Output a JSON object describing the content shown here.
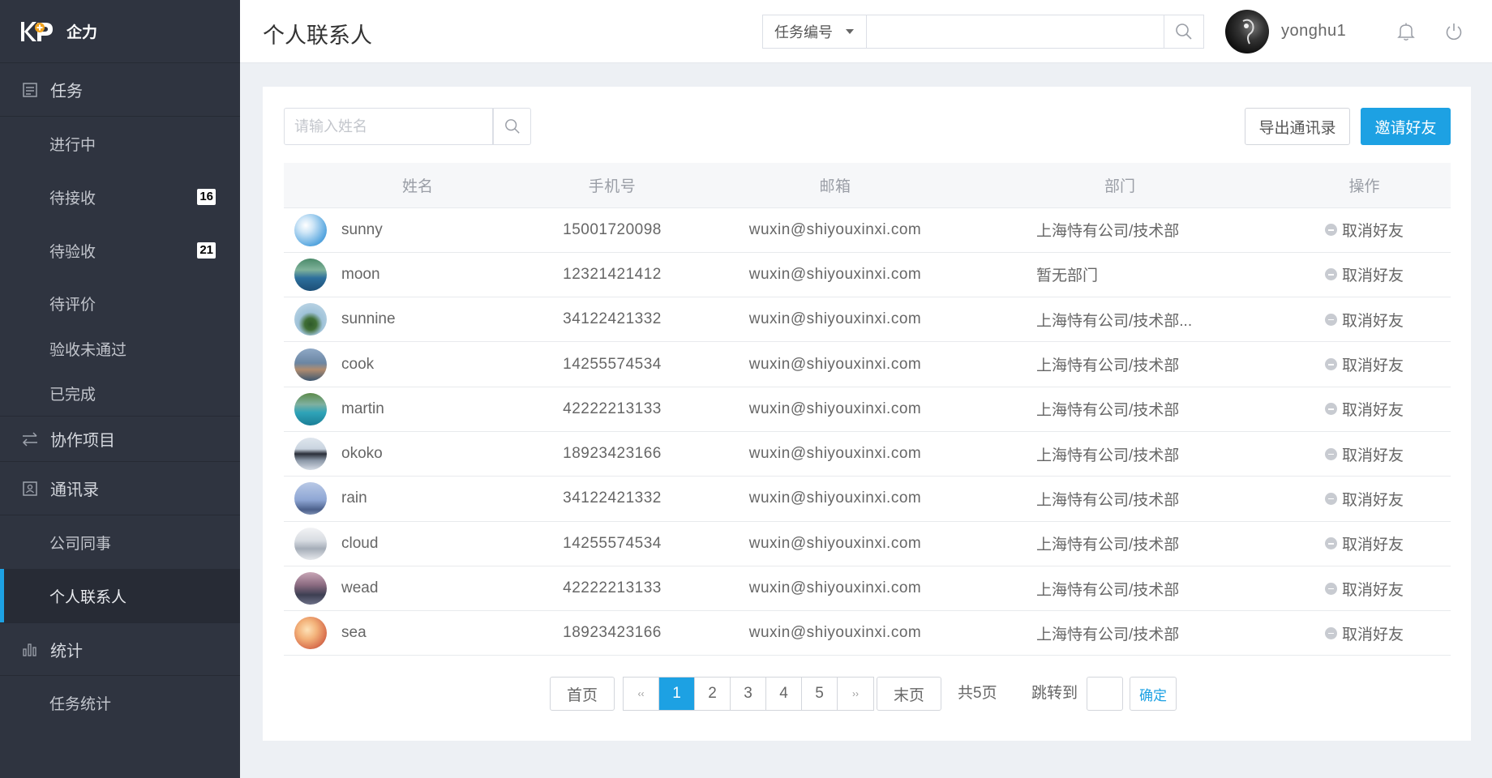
{
  "brand": {
    "name": "企力"
  },
  "sidebar": {
    "groups": [
      {
        "label": "任务",
        "icon": "task-icon"
      },
      {
        "label": "协作项目",
        "icon": "swap-icon"
      },
      {
        "label": "通讯录",
        "icon": "contacts-icon"
      },
      {
        "label": "统计",
        "icon": "bar-chart-icon"
      }
    ],
    "task_items": [
      {
        "label": "进行中"
      },
      {
        "label": "待接收",
        "badge": "16"
      },
      {
        "label": "待验收",
        "badge": "21"
      },
      {
        "label": "待评价"
      },
      {
        "label": "验收未通过"
      },
      {
        "label": "已完成"
      }
    ],
    "contact_items": [
      {
        "label": "公司同事"
      },
      {
        "label": "个人联系人"
      }
    ],
    "stats_items": [
      {
        "label": "任务统计"
      }
    ]
  },
  "header": {
    "title": "个人联系人",
    "search_type": "任务编号",
    "search_value": "",
    "username": "yonghu1"
  },
  "toolbar": {
    "name_placeholder": "请输入姓名",
    "export_label": "导出通讯录",
    "invite_label": "邀请好友"
  },
  "table": {
    "columns": [
      "姓名",
      "手机号",
      "邮箱",
      "部门",
      "操作"
    ],
    "rows": [
      {
        "name": "sunny",
        "phone": "15001720098",
        "email": "wuxin@shiyouxinxi.com",
        "dept": "上海恃有公司/技术部",
        "op": "取消好友"
      },
      {
        "name": "moon",
        "phone": "12321421412",
        "email": "wuxin@shiyouxinxi.com",
        "dept": "暂无部门",
        "op": "取消好友"
      },
      {
        "name": "sunnine",
        "phone": "34122421332",
        "email": "wuxin@shiyouxinxi.com",
        "dept": "上海恃有公司/技术部...",
        "op": "取消好友"
      },
      {
        "name": "cook",
        "phone": "14255574534",
        "email": "wuxin@shiyouxinxi.com",
        "dept": "上海恃有公司/技术部",
        "op": "取消好友"
      },
      {
        "name": "martin",
        "phone": "42222213133",
        "email": "wuxin@shiyouxinxi.com",
        "dept": "上海恃有公司/技术部",
        "op": "取消好友"
      },
      {
        "name": "okoko",
        "phone": "18923423166",
        "email": "wuxin@shiyouxinxi.com",
        "dept": "上海恃有公司/技术部",
        "op": "取消好友"
      },
      {
        "name": "rain",
        "phone": "34122421332",
        "email": "wuxin@shiyouxinxi.com",
        "dept": "上海恃有公司/技术部",
        "op": "取消好友"
      },
      {
        "name": "cloud",
        "phone": "14255574534",
        "email": "wuxin@shiyouxinxi.com",
        "dept": "上海恃有公司/技术部",
        "op": "取消好友"
      },
      {
        "name": "wead",
        "phone": "42222213133",
        "email": "wuxin@shiyouxinxi.com",
        "dept": "上海恃有公司/技术部",
        "op": "取消好友"
      },
      {
        "name": "sea",
        "phone": "18923423166",
        "email": "wuxin@shiyouxinxi.com",
        "dept": "上海恃有公司/技术部",
        "op": "取消好友"
      }
    ]
  },
  "pagination": {
    "first": "首页",
    "prev": "‹‹",
    "pages": [
      "1",
      "2",
      "3",
      "4",
      "5"
    ],
    "current": "1",
    "next": "››",
    "last": "末页",
    "total": "共5页",
    "jump_label": "跳转到",
    "confirm": "确定"
  },
  "colors": {
    "accent": "#1da1e3",
    "sidebar_bg": "#2f3440",
    "page_bg": "#edf0f4"
  }
}
